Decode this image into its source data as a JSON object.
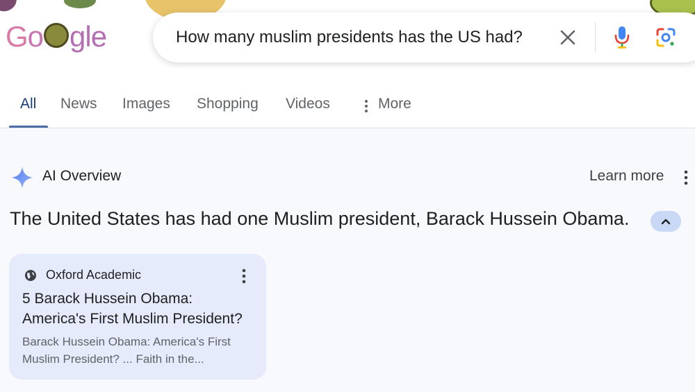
{
  "logo": {
    "text_first": "G",
    "text_o": "o",
    "text_rest": "gle"
  },
  "search": {
    "query": "How many muslim presidents has the US had?",
    "clear_icon": "close-icon",
    "mic_icon": "mic-icon",
    "lens_icon": "google-lens-icon"
  },
  "tabs": {
    "all": "All",
    "news": "News",
    "images": "Images",
    "shopping": "Shopping",
    "videos": "Videos",
    "more": "More"
  },
  "ai_overview": {
    "title": "AI Overview",
    "learn_more": "Learn more",
    "answer": "The United States has had one Muslim president, Barack Hussein Obama."
  },
  "source_card": {
    "source": "Oxford Academic",
    "title": "5 Barack Hussein Obama: America's First Muslim President?",
    "snippet": "Barack Hussein Obama: America's First Muslim President? ... Faith in the..."
  },
  "colors": {
    "accent": "#4a6aa8",
    "card_bg": "#e5ebfb",
    "chip_bg": "#c9d9f5"
  }
}
